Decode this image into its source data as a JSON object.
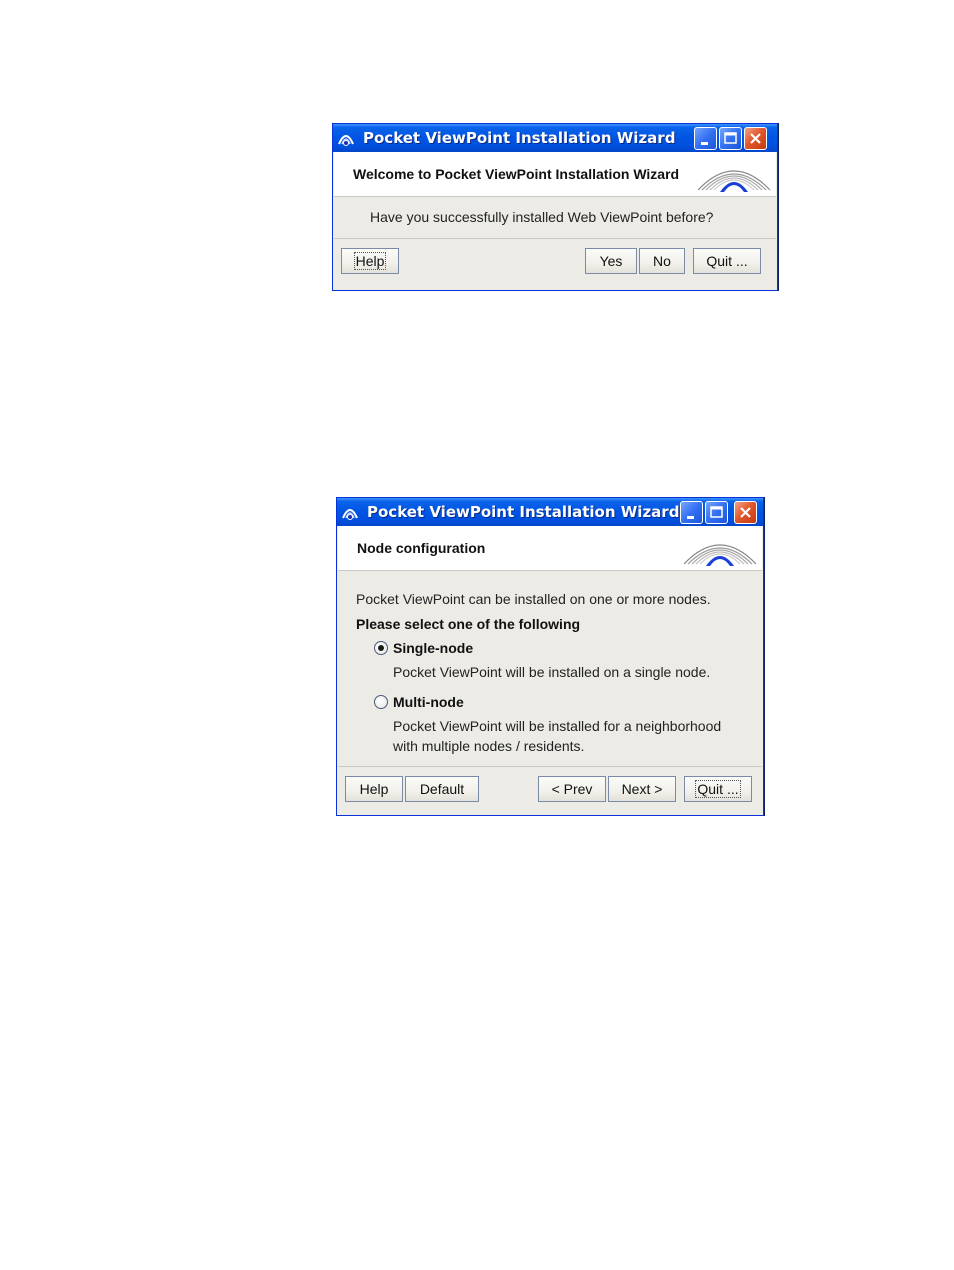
{
  "colors": {
    "titlebar": "#0054e3",
    "window_bg": "#ecebe6",
    "header_bg": "#ffffff",
    "close_button": "#e3582c"
  },
  "dialog1": {
    "window_title": "Pocket ViewPoint Installation Wizard",
    "header_title": "Welcome to Pocket ViewPoint Installation Wizard",
    "question": "Have you successfully installed Web ViewPoint before?",
    "buttons": {
      "help": "Help",
      "yes": "Yes",
      "no": "No",
      "quit": "Quit ..."
    }
  },
  "dialog2": {
    "window_title": "Pocket ViewPoint Installation Wizard",
    "header_title": "Node configuration",
    "intro": "Pocket ViewPoint can be installed on one or more nodes.",
    "prompt": "Please select one of the following",
    "options": [
      {
        "label": "Single-node",
        "selected": true,
        "description_lines": [
          "Pocket ViewPoint will be installed on a single node."
        ]
      },
      {
        "label": "Multi-node",
        "selected": false,
        "description_lines": [
          "Pocket ViewPoint will be installed for a neighborhood",
          "with multiple nodes / residents."
        ]
      }
    ],
    "buttons": {
      "help": "Help",
      "default": "Default",
      "prev": "< Prev",
      "next": "Next >",
      "quit": "Quit ..."
    }
  },
  "icons": {
    "app": "satellite-dish-icon",
    "minimize": "minimize-icon",
    "maximize": "maximize-icon",
    "close": "close-icon",
    "logo": "viewpoint-dome-logo"
  }
}
